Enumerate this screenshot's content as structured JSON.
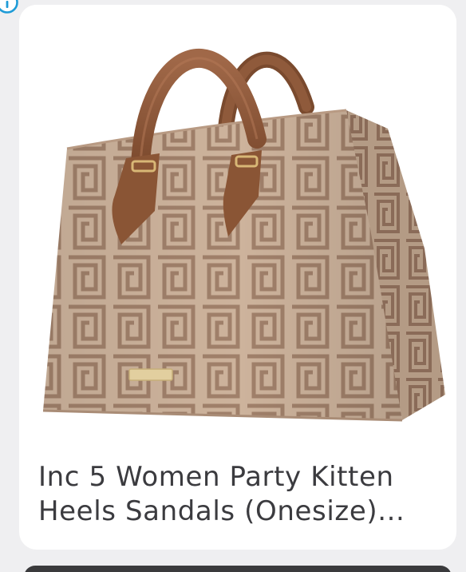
{
  "product": {
    "title": "Inc 5 Women Party Kitten Heels Sandals (Onesize)...",
    "image_icon": "handbag-image",
    "info_icon": "info-icon"
  },
  "colors": {
    "page_background": "#efeff1",
    "card_background": "#ffffff",
    "title_text": "#3b3b3f",
    "info_icon": "#1e9bd7",
    "bag_base": "#cbb29b",
    "bag_pattern": "#9e7f68",
    "strap_leather": "#8a5535"
  }
}
